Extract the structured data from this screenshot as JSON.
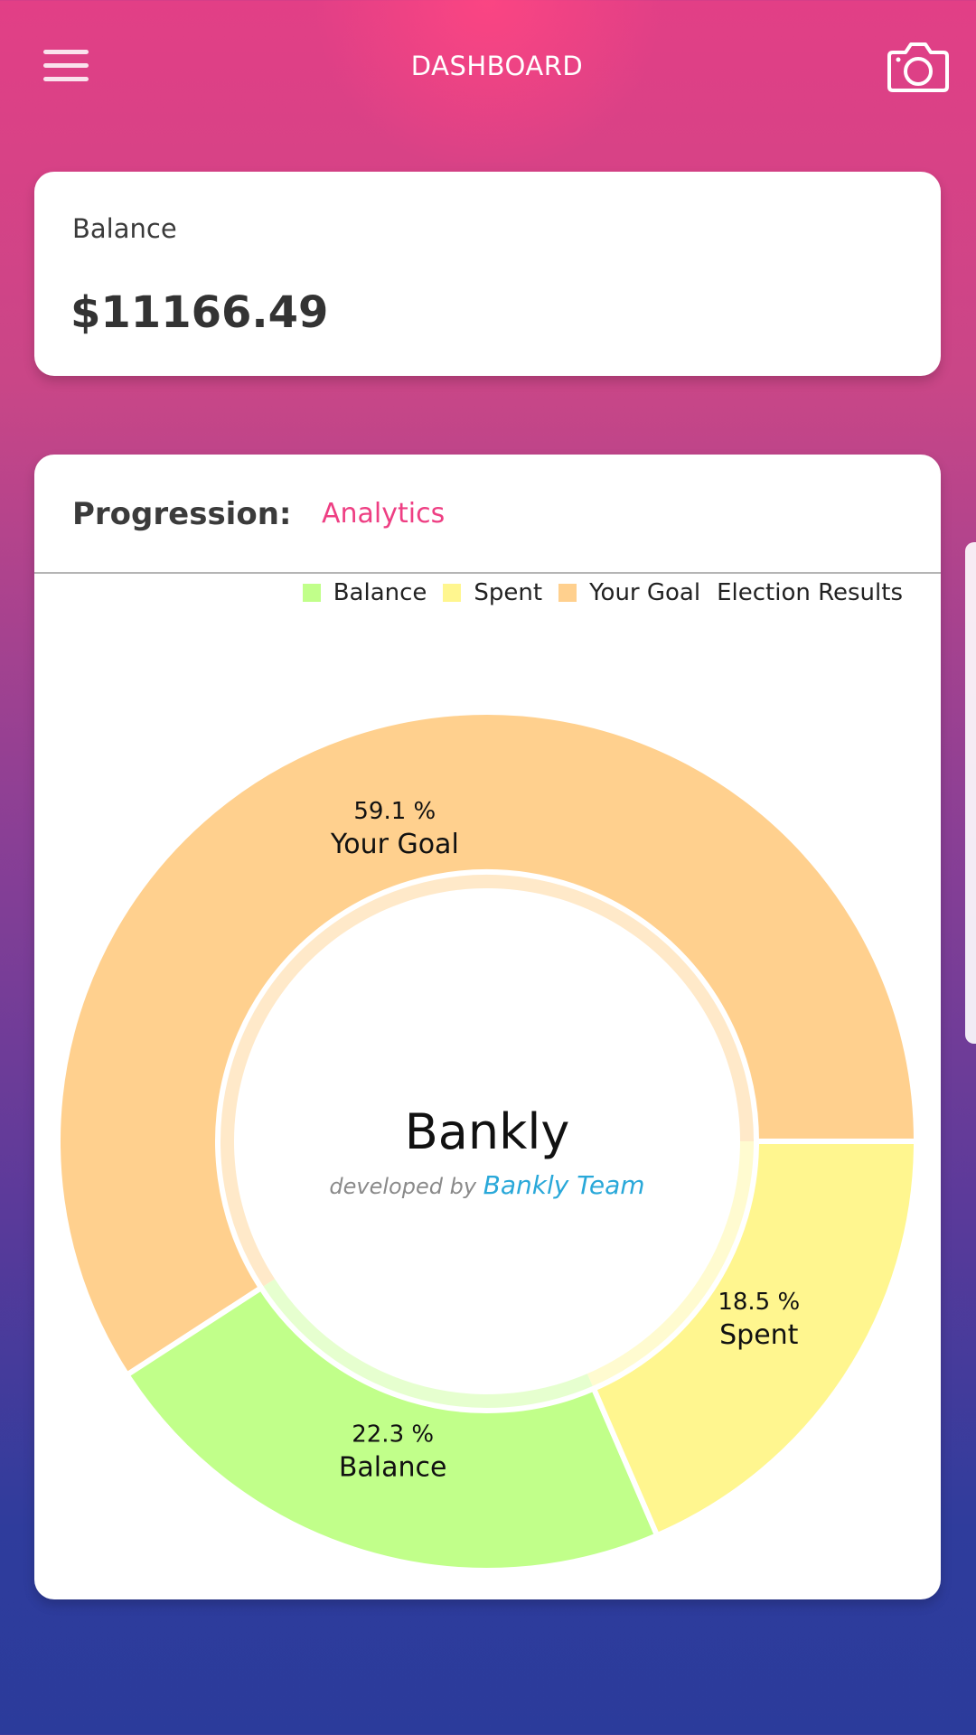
{
  "header": {
    "title": "DASHBOARD",
    "menu_icon": "hamburger-icon",
    "camera_icon": "camera-icon"
  },
  "balance_card": {
    "label": "Balance",
    "value": "$11166.49"
  },
  "progression_card": {
    "label": "Progression:",
    "link": "Analytics",
    "center_title": "Bankly",
    "center_subtitle_1": "developed by",
    "center_subtitle_2": "Bankly Team"
  },
  "colors": {
    "accent": "#ee3f83",
    "balance": "#c1ff8a",
    "spent": "#fff68f",
    "goal": "#ffd08e",
    "brand_blue": "#29a8d9"
  },
  "chart_data": {
    "type": "pie",
    "title": "Election Results",
    "legend_position": "top-right",
    "series": [
      {
        "name": "Your Goal",
        "value": 59.1,
        "label": "59.1 %"
      },
      {
        "name": "Balance",
        "value": 22.3,
        "label": "22.3 %"
      },
      {
        "name": "Spent",
        "value": 18.5,
        "label": "18.5 %"
      }
    ],
    "legend": [
      "Balance",
      "Spent",
      "Your Goal"
    ]
  }
}
